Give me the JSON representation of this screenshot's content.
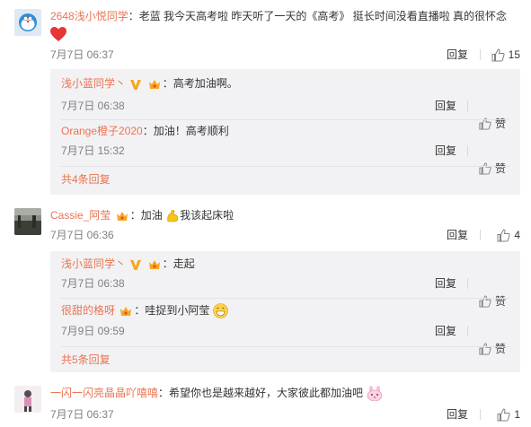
{
  "comments": [
    {
      "username": "2648浅小悦同学",
      "text": "：老蓝 我今天高考啦 昨天听了一天的《高考》 挺长时间没看直播啦 真的很怀念",
      "emoji": "heart-emoji",
      "date": "7月7日 06:37",
      "reply_label": "回复",
      "like_count": "15",
      "replies": [
        {
          "username": "浅小蓝同学丶",
          "text": "：高考加油啊。",
          "date": "7月7日 06:38",
          "reply_label": "回复",
          "like_label": "赞"
        },
        {
          "username": "Orange橙子2020",
          "text": "：加油！高考顺利",
          "date": "7月7日 15:32",
          "reply_label": "回复",
          "like_label": "赞"
        }
      ],
      "more_replies": "共4条回复"
    },
    {
      "username": "Cassie_阿莹",
      "text_before": "：加油",
      "text_after": "我该起床啦",
      "date": "7月7日 06:36",
      "reply_label": "回复",
      "like_count": "4",
      "replies": [
        {
          "username": "浅小蓝同学丶",
          "text": "：走起",
          "date": "7月7日 06:38",
          "reply_label": "回复",
          "like_label": "赞"
        },
        {
          "username": "很甜的格呀",
          "text": "：哇捉到小阿莹",
          "date": "7月9日 09:59",
          "reply_label": "回复",
          "like_label": "赞"
        }
      ],
      "more_replies": "共5条回复"
    },
    {
      "username": "一闪一闪亮晶晶吖嘻嘻",
      "text": "：希望你也是越来越好，大家彼此都加油吧",
      "date": "7月7日 06:37",
      "reply_label": "回复",
      "like_count": "1"
    }
  ],
  "colors": {
    "username": "#eb7350",
    "reply_bg": "#f2f2f5",
    "text": "#333333",
    "meta": "#808080"
  }
}
